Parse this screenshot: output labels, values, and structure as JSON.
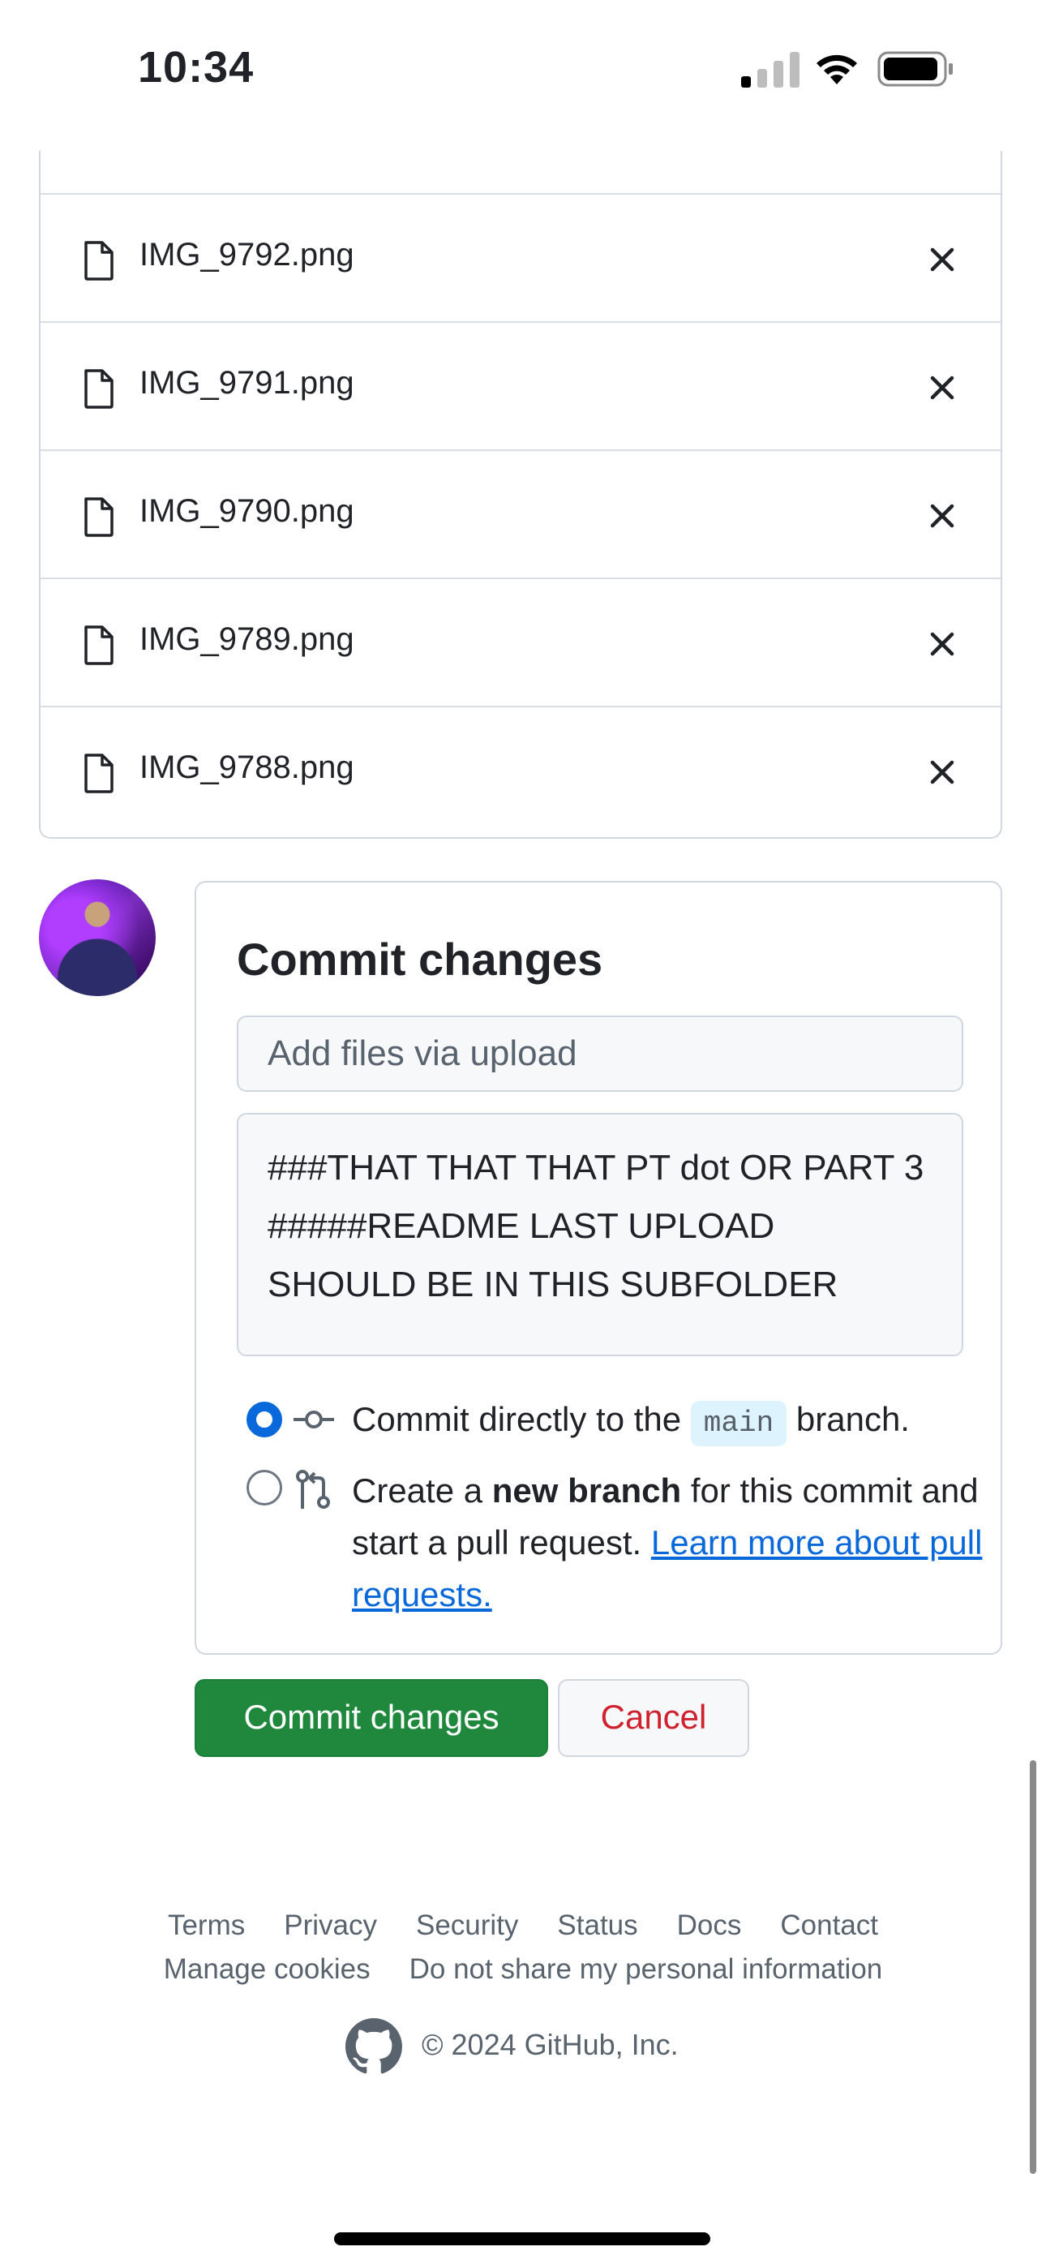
{
  "status_bar": {
    "time": "10:34"
  },
  "files": [
    {
      "name": "IMG_9792.png"
    },
    {
      "name": "IMG_9791.png"
    },
    {
      "name": "IMG_9790.png"
    },
    {
      "name": "IMG_9789.png"
    },
    {
      "name": "IMG_9788.png"
    }
  ],
  "commit": {
    "title": "Commit changes",
    "summary_placeholder": "Add files via upload",
    "description": "###THAT THAT THAT PT dot OR PART 3\n#####README LAST UPLOAD SHOULD BE IN THIS SUBFOLDER",
    "option_direct_prefix": "Commit directly to the",
    "branch_name": "main",
    "option_direct_suffix": "branch.",
    "option_new_prefix": "Create a",
    "option_new_bold": "new branch",
    "option_new_suffix": "for this commit and start a pull request.",
    "learn_more_link": "Learn more about pull requests.",
    "selected_option": "direct"
  },
  "buttons": {
    "commit_label": "Commit changes",
    "cancel_label": "Cancel"
  },
  "footer": {
    "links_row1": [
      "Terms",
      "Privacy",
      "Security",
      "Status",
      "Docs",
      "Contact"
    ],
    "links_row2": [
      "Manage cookies",
      "Do not share my personal information"
    ],
    "copyright": "© 2024 GitHub, Inc."
  },
  "colors": {
    "primary_button": "#1f883d",
    "cancel_text": "#cf222e",
    "link": "#0969da",
    "radio_selected": "#0969da"
  }
}
